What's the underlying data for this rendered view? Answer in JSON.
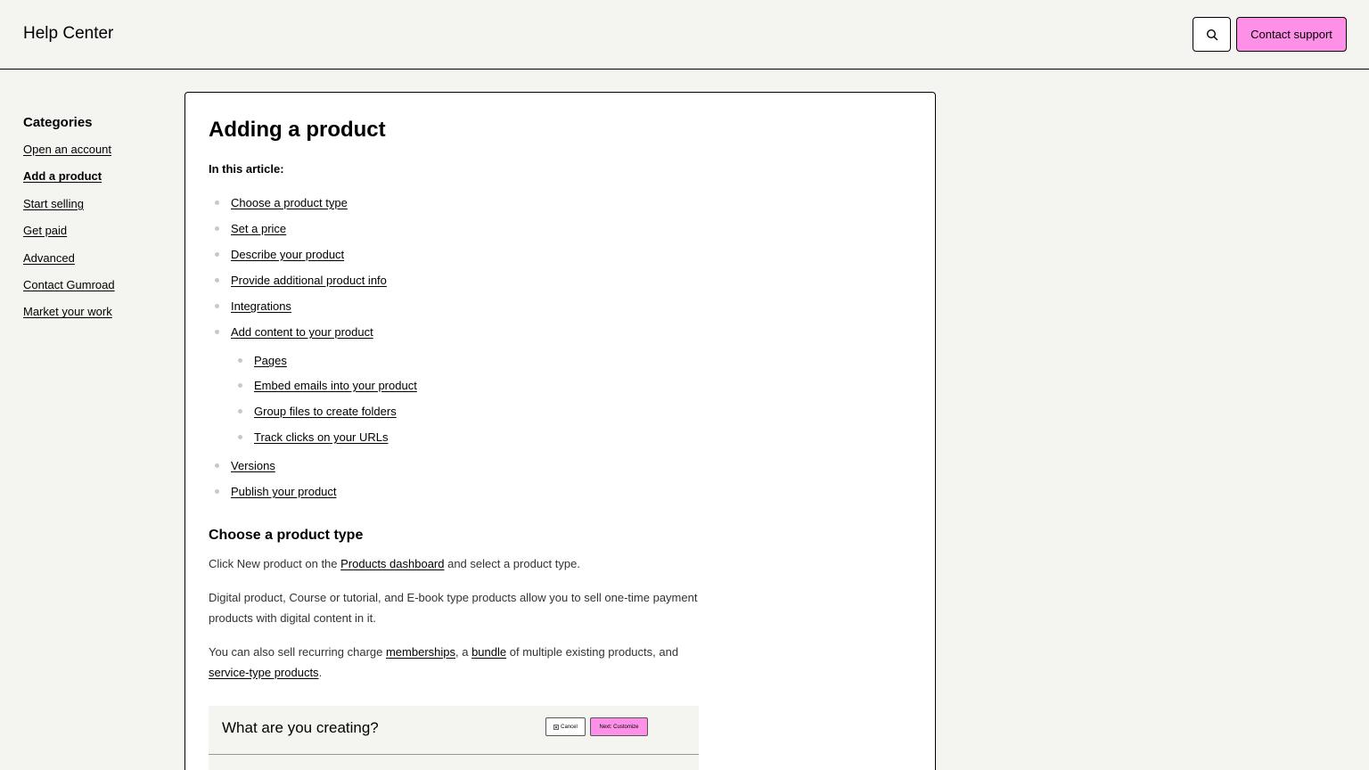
{
  "header": {
    "title": "Help Center",
    "search_icon": "search-icon",
    "contact_label": "Contact support",
    "accent_color": "#ff90e8"
  },
  "sidebar": {
    "heading": "Categories",
    "items": [
      {
        "label": "Open an account"
      },
      {
        "label": "Add a product",
        "active": true
      },
      {
        "label": "Start selling"
      },
      {
        "label": "Get paid"
      },
      {
        "label": "Advanced"
      },
      {
        "label": "Contact Gumroad"
      },
      {
        "label": "Market your work"
      }
    ]
  },
  "article": {
    "title": "Adding a product",
    "toc_label": "In this article:",
    "toc": [
      {
        "label": "Choose a product type"
      },
      {
        "label": "Set a price"
      },
      {
        "label": "Describe your product"
      },
      {
        "label": "Provide additional product info"
      },
      {
        "label": "Integrations"
      },
      {
        "label": "Add content to your product"
      },
      {
        "label": "Pages",
        "sub": true
      },
      {
        "label": "Embed emails into your product",
        "sub": true
      },
      {
        "label": "Group files to create folders",
        "sub": true
      },
      {
        "label": "Track clicks on your URLs",
        "sub": true
      },
      {
        "label": "Versions"
      },
      {
        "label": "Publish your product"
      }
    ],
    "section_heading": "Choose a product type",
    "p1_before": "Click New product on the ",
    "p1_link": "Products dashboard",
    "p1_after": " and select a product type.",
    "p2": "Digital product, Course or tutorial, and E-book type products allow you to sell one-time payment products with digital content in it.",
    "p3_before": "You can also sell recurring charge ",
    "p3_link1": "memberships",
    "p3_mid1": ", a ",
    "p3_link2": "bundle",
    "p3_mid2": " of multiple existing products, and ",
    "p3_link3": "service-type products",
    "p3_after": ".",
    "preview": {
      "title": "What are you creating?",
      "cancel_label": "Cancel",
      "next_label": "Next: Customize"
    }
  }
}
